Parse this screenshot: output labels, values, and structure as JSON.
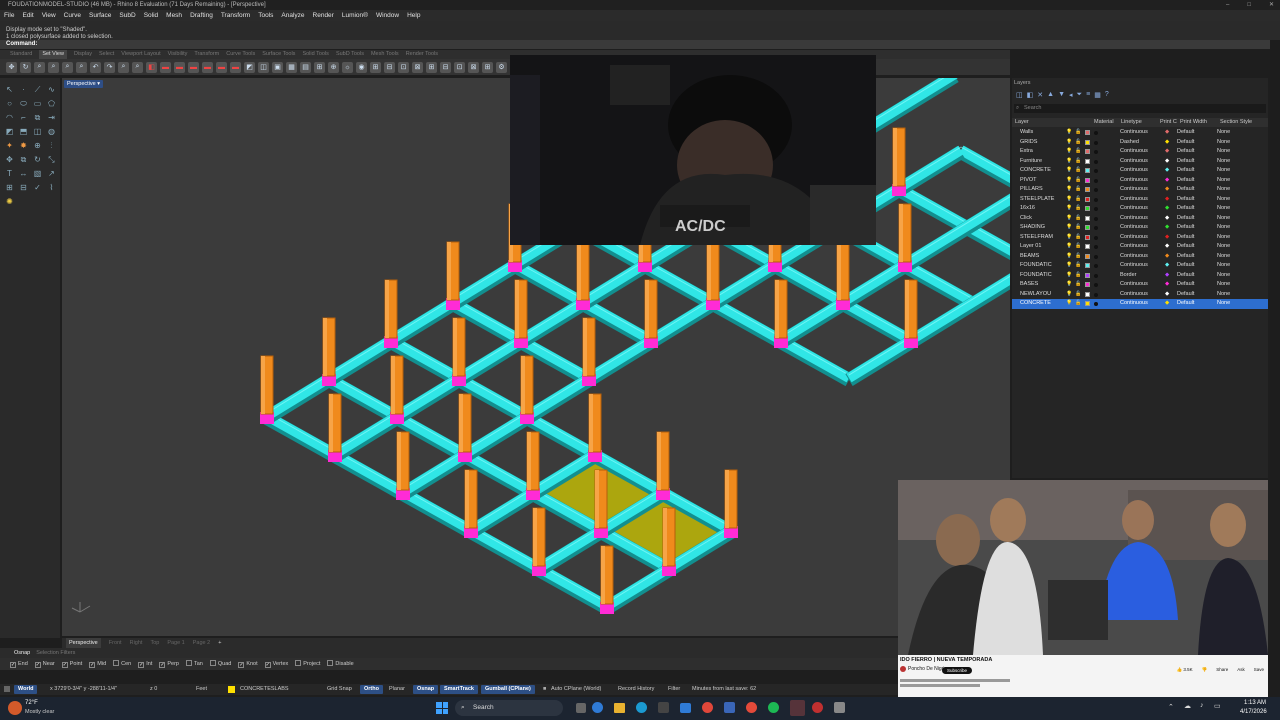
{
  "window": {
    "title": "FOUDATIONMODEL-STUDIO (46 MB) - Rhino 8 Evaluation (71 Days Remaining) - [Perspective]"
  },
  "menu": [
    "File",
    "Edit",
    "View",
    "Curve",
    "Surface",
    "SubD",
    "Solid",
    "Mesh",
    "Drafting",
    "Transform",
    "Tools",
    "Analyze",
    "Render",
    "Lumion®",
    "Window",
    "Help"
  ],
  "command_history": [
    "Display mode set to \"Shaded\".",
    "1 closed polysurface added to selection."
  ],
  "command_prompt": "Command:",
  "toolbar_tabs": [
    "Standard",
    "Set View",
    "Display",
    "Select",
    "Viewport Layout",
    "Visibility",
    "Transform",
    "Curve Tools",
    "Surface Tools",
    "Solid Tools",
    "SubD Tools",
    "Mesh Tools",
    "Render Tools"
  ],
  "active_toolbar_tab": "Set View",
  "viewport": {
    "label": "Perspective"
  },
  "layers_panel": {
    "title": "Layers",
    "search_placeholder": "Search",
    "columns": [
      "Layer",
      "Material",
      "Linetype",
      "Print C",
      "Print Width",
      "Section Style"
    ],
    "rows": [
      {
        "name": "Walls",
        "color": "#e06a6a",
        "linetype": "Continuous",
        "print_color": "#e06a6a",
        "print_width": "Default",
        "section": "None"
      },
      {
        "name": "GRIDS",
        "color": "#ffe000",
        "linetype": "Dashed",
        "print_color": "#ffe000",
        "print_width": "Default",
        "section": "None"
      },
      {
        "name": "Extra",
        "color": "#e06a6a",
        "linetype": "Continuous",
        "print_color": "#e06a6a",
        "print_width": "Default",
        "section": "None"
      },
      {
        "name": "Furniture",
        "color": "#ffffff",
        "linetype": "Continuous",
        "print_color": "#ffffff",
        "print_width": "Default",
        "section": "None"
      },
      {
        "name": "CONCRETE",
        "color": "#5ef0f0",
        "linetype": "Continuous",
        "print_color": "#5ef0f0",
        "print_width": "Default",
        "section": "None"
      },
      {
        "name": "PIVOT",
        "color": "#ff2bd6",
        "linetype": "Continuous",
        "print_color": "#ff2bd6",
        "print_width": "Default",
        "section": "None"
      },
      {
        "name": "PILLARS",
        "color": "#f08a1c",
        "linetype": "Continuous",
        "print_color": "#f08a1c",
        "print_width": "Default",
        "section": "None"
      },
      {
        "name": "STEELPLATE",
        "color": "#e02020",
        "linetype": "Continuous",
        "print_color": "#e02020",
        "print_width": "Default",
        "section": "None"
      },
      {
        "name": "16x16",
        "color": "#30e030",
        "linetype": "Continuous",
        "print_color": "#30e030",
        "print_width": "Default",
        "section": "None"
      },
      {
        "name": "Click",
        "color": "#ffffff",
        "linetype": "Continuous",
        "print_color": "#ffffff",
        "print_width": "Default",
        "section": "None"
      },
      {
        "name": "SHADING",
        "color": "#30e030",
        "linetype": "Continuous",
        "print_color": "#30e030",
        "print_width": "Default",
        "section": "None"
      },
      {
        "name": "STEELFRAM",
        "color": "#e02020",
        "linetype": "Continuous",
        "print_color": "#e02020",
        "print_width": "Default",
        "section": "None"
      },
      {
        "name": "Layer 01",
        "color": "#ffffff",
        "linetype": "Continuous",
        "print_color": "#ffffff",
        "print_width": "Default",
        "section": "None"
      },
      {
        "name": "BEAMS",
        "color": "#f08a1c",
        "linetype": "Continuous",
        "print_color": "#f08a1c",
        "print_width": "Default",
        "section": "None"
      },
      {
        "name": "FOUNDATIC",
        "color": "#5ef0f0",
        "linetype": "Continuous",
        "print_color": "#5ef0f0",
        "print_width": "Default",
        "section": "None"
      },
      {
        "name": "FOUNDATIC",
        "color": "#b040ff",
        "linetype": "Border",
        "print_color": "#b040ff",
        "print_width": "Default",
        "section": "None"
      },
      {
        "name": "BASES",
        "color": "#ff2bd6",
        "linetype": "Continuous",
        "print_color": "#ff2bd6",
        "print_width": "Default",
        "section": "None"
      },
      {
        "name": "NEWLAYOU",
        "color": "#ffffff",
        "linetype": "Continuous",
        "print_color": "#ffffff",
        "print_width": "Default",
        "section": "None"
      },
      {
        "name": "CONCRETE",
        "color": "#ffe000",
        "linetype": "Continuous",
        "print_color": "#ffe000",
        "print_width": "Default",
        "section": "None",
        "selected": true
      }
    ]
  },
  "view_tabs": [
    "Perspective",
    "Front",
    "Right",
    "Top",
    "Page 1",
    "Page 2"
  ],
  "active_view_tab": "Perspective",
  "osnap_tabs": [
    "Osnap",
    "Selection Filters"
  ],
  "osnaps": [
    {
      "label": "End",
      "checked": true
    },
    {
      "label": "Near",
      "checked": true
    },
    {
      "label": "Point",
      "checked": true
    },
    {
      "label": "Mid",
      "checked": true
    },
    {
      "label": "Cen",
      "checked": false
    },
    {
      "label": "Int",
      "checked": true
    },
    {
      "label": "Perp",
      "checked": true
    },
    {
      "label": "Tan",
      "checked": false
    },
    {
      "label": "Quad",
      "checked": false
    },
    {
      "label": "Knot",
      "checked": true
    },
    {
      "label": "Vertex",
      "checked": true
    },
    {
      "label": "Project",
      "checked": false
    },
    {
      "label": "Disable",
      "checked": false
    }
  ],
  "statusbar": {
    "cplane": "World",
    "coords": "x 3729'0-3/4\"  y -288'11-1/4\"",
    "z": "z 0",
    "units": "Feet",
    "layer": "CONCRETESLABS",
    "layer_color": "#ffe000",
    "toggles": [
      {
        "label": "Grid Snap",
        "on": false
      },
      {
        "label": "Ortho",
        "on": true
      },
      {
        "label": "Planar",
        "on": false
      },
      {
        "label": "Osnap",
        "on": true
      },
      {
        "label": "SmartTrack",
        "on": true
      },
      {
        "label": "Gumball (CPlane)",
        "on": true
      }
    ],
    "auto_cplane": "Auto CPlane (World)",
    "record_history": "Record History",
    "filter": "Filter",
    "minutes": "Minutes from last save: 62"
  },
  "youtube": {
    "title": "IDO FIERRO | NUEVA TEMPORADA",
    "channel": "Poncho De Nigris",
    "subscribe": "Subscribe",
    "likes": "3.5K",
    "share": "Share",
    "ask": "Ask",
    "save": "Save"
  },
  "taskbar": {
    "weather_temp": "72°F",
    "weather_desc": "Mostly clear",
    "search_placeholder": "Search",
    "time": "1:13 AM",
    "date": "4/17/2026"
  },
  "colors": {
    "concrete": "#30e6e6",
    "pillar": "#f08a1c",
    "base": "#ff2bd6",
    "slab": "#b9b30a",
    "accent": "#2d6ecf"
  }
}
